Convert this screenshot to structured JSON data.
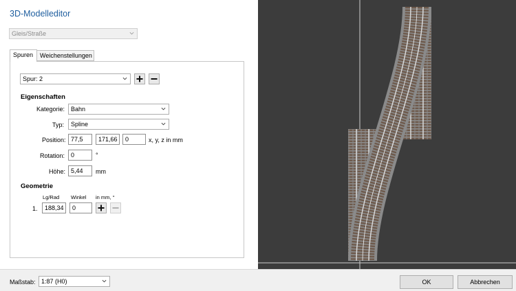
{
  "window": {
    "title": "3D-Modelleditor"
  },
  "type_select": {
    "value": "Gleis/Straße"
  },
  "tabs": [
    {
      "label": "Spuren"
    },
    {
      "label": "Weichenstellungen"
    }
  ],
  "track": {
    "select_value": "Spur: 2"
  },
  "properties": {
    "heading": "Eigenschaften",
    "category_label": "Kategorie:",
    "category_value": "Bahn",
    "type_label": "Typ:",
    "type_value": "Spline",
    "position_label": "Position:",
    "position_x": "77,5",
    "position_y": "171,66",
    "position_z": "0",
    "position_unit": "x, y, z in mm",
    "rotation_label": "Rotation:",
    "rotation_value": "0",
    "rotation_unit": "°",
    "height_label": "Höhe:",
    "height_value": "5,44",
    "height_unit": "mm"
  },
  "geometry": {
    "heading": "Geometrie",
    "col_length": "Lg/Rad",
    "col_angle": "Winkel",
    "col_unit": "in mm, °",
    "rows": [
      {
        "index": "1.",
        "length": "188,34",
        "angle": "0"
      }
    ]
  },
  "footer": {
    "scale_label": "Maßstab:",
    "scale_value": "1:87 (H0)",
    "ok_label": "OK",
    "cancel_label": "Abbrechen"
  },
  "colors": {
    "viewport_bg": "#3c3c3c",
    "ballast": "#8a8a8a",
    "sleeper": "#6e5a4c",
    "rail": "#d9d9d9",
    "title": "#1d5d9e"
  },
  "icons": {
    "dropdown": "chevron-down-icon",
    "add": "plus-icon",
    "remove": "minus-icon"
  }
}
